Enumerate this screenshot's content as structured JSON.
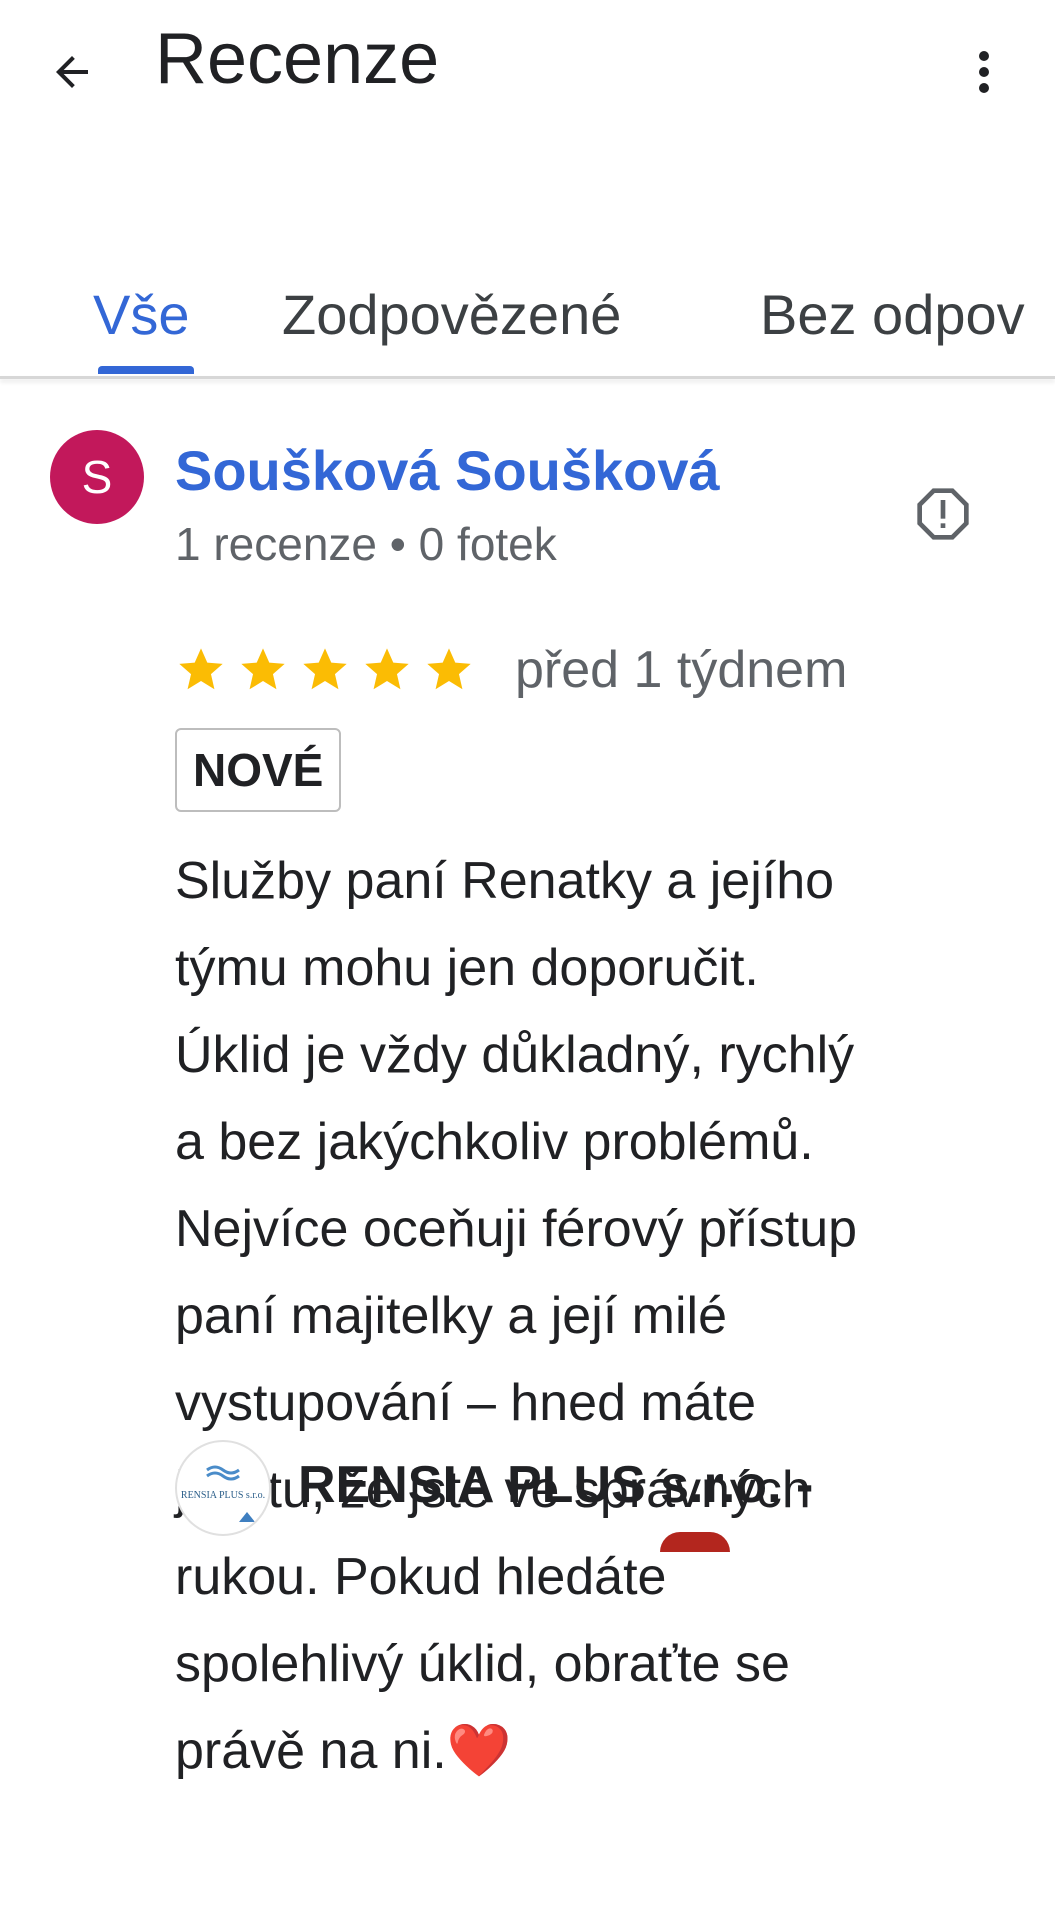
{
  "header": {
    "title": "Recenze",
    "back_icon": "arrow-left-icon",
    "more_icon": "more-vertical-icon"
  },
  "tabs": [
    {
      "label": "Vše",
      "active": true
    },
    {
      "label": "Zodpovězené",
      "active": false
    },
    {
      "label": "Bez odpov",
      "active": false
    }
  ],
  "review": {
    "avatar_letter": "S",
    "avatar_color": "#c2185b",
    "author": "Soušková Soušková",
    "meta": "1 recenze • 0 fotek",
    "rating": 5,
    "time": "před 1 týdnem",
    "badge": "NOVÉ",
    "text_lines": [
      "Služby paní Renatky a jejího",
      "týmu mohu jen doporučit.",
      "Úklid je vždy důkladný, rychlý",
      "a bez jakýchkoliv problémů.",
      "Nejvíce oceňuji férový přístup",
      "paní majitelky a její milé",
      "vystupování – hned máte",
      "jistotu, že jste ve správných",
      "rukou. Pokud hledáte",
      "spolehlivý úklid, obraťte se",
      "právě na ni."
    ],
    "emoji": "❤️"
  },
  "owner_reply": {
    "name": "RENSIA PLUS s.r.o. -",
    "logo_text": "RENSIA PLUS s.r.o."
  },
  "colors": {
    "accent": "#3367d6",
    "star": "#fbbc04",
    "text_secondary": "#5f6368"
  }
}
